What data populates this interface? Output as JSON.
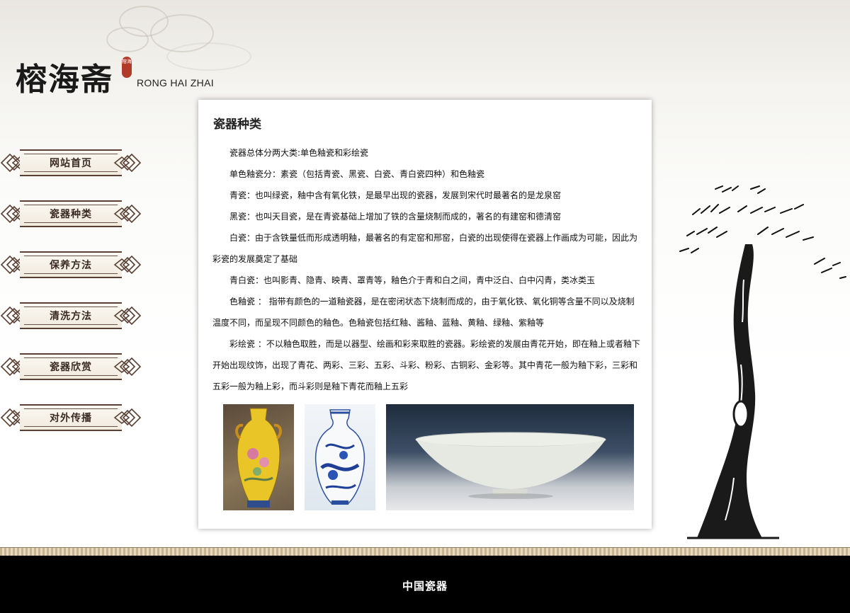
{
  "brand": {
    "name_cn": "榕海斋",
    "name_en": "RONG HAI ZHAI",
    "seal_text": "榕海"
  },
  "nav": {
    "items": [
      {
        "label": "网站首页"
      },
      {
        "label": "瓷器种类"
      },
      {
        "label": "保养方法"
      },
      {
        "label": "清洗方法"
      },
      {
        "label": "瓷器欣赏"
      },
      {
        "label": "对外传播"
      }
    ]
  },
  "content": {
    "title": "瓷器种类",
    "paragraphs": [
      "瓷器总体分两大类:单色釉瓷和彩绘瓷",
      "单色釉瓷分：素瓷（包括青瓷、黑瓷、白瓷、青白瓷四种）和色釉瓷",
      "青瓷：也叫绿瓷，釉中含有氧化铁，是最早出现的瓷器，发展到宋代时最著名的是龙泉窑",
      "黑瓷：也叫天目瓷，是在青瓷基础上增加了铁的含量烧制而成的，著名的有建窑和德清窑",
      "白瓷：由于含铁量低而形成透明釉，最著名的有定窑和邢窑，白瓷的出现使得在瓷器上作画成为可能，因此为彩瓷的发展奠定了基础",
      "青白瓷：也叫影青、隐青、映青、罩青等，釉色介于青和白之间，青中泛白、白中闪青，类冰类玉",
      "色釉瓷 ： 指带有颜色的一道釉瓷器，是在密闭状态下烧制而成的，由于氧化铁、氧化铜等含量不同以及烧制温度不同，而呈现不同颜色的釉色。色釉瓷包括红釉、酱釉、蓝釉、黄釉、绿釉、紫釉等",
      "彩绘瓷 ：不以釉色取胜，而是以器型、绘画和彩来取胜的瓷器。彩绘瓷的发展由青花开始，即在釉上或者釉下开始出现纹饰，出现了青花、两彩、三彩、五彩、斗彩、粉彩、古铜彩、金彩等。其中青花一般为釉下彩，三彩和五彩一般为釉上彩，而斗彩则是釉下青花而釉上五彩"
    ]
  },
  "footer": {
    "text": "中国瓷器"
  },
  "colors": {
    "nav_border": "#5a3f33",
    "footer_bg": "#000000",
    "seal_red": "#b23a2a"
  }
}
